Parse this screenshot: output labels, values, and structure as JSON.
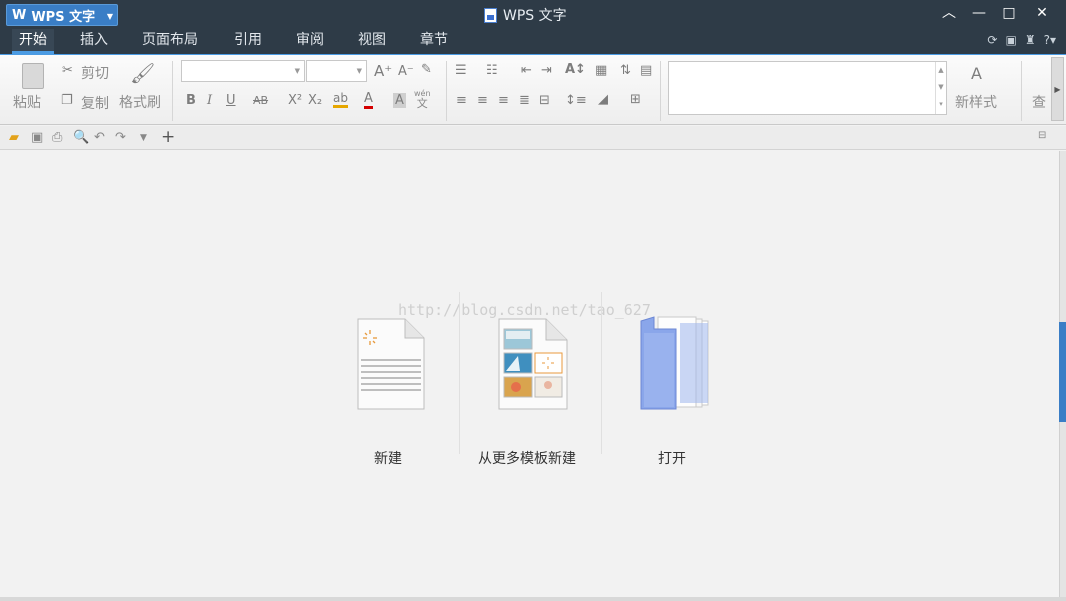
{
  "app_menu": {
    "label": "WPS 文字"
  },
  "window": {
    "title": "WPS 文字"
  },
  "tabs": [
    {
      "label": "开始"
    },
    {
      "label": "插入"
    },
    {
      "label": "页面布局"
    },
    {
      "label": "引用"
    },
    {
      "label": "审阅"
    },
    {
      "label": "视图"
    },
    {
      "label": "章节"
    }
  ],
  "ribbon": {
    "paste_label": "粘贴",
    "cut_label": "剪切",
    "copy_label": "复制",
    "format_painter_label": "格式刷",
    "bold": "B",
    "italic": "I",
    "underline": "U",
    "strike": "AB",
    "superscript": "X²",
    "subscript": "X₂",
    "pinyin_top": "wén",
    "pinyin_bottom": "文",
    "font_color": "A",
    "new_style_label": "新样式",
    "find_label": "查"
  },
  "watermark": "http://blog.csdn.net/tao_627",
  "start": {
    "new_label": "新建",
    "template_label": "从更多模板新建",
    "open_label": "打开"
  }
}
